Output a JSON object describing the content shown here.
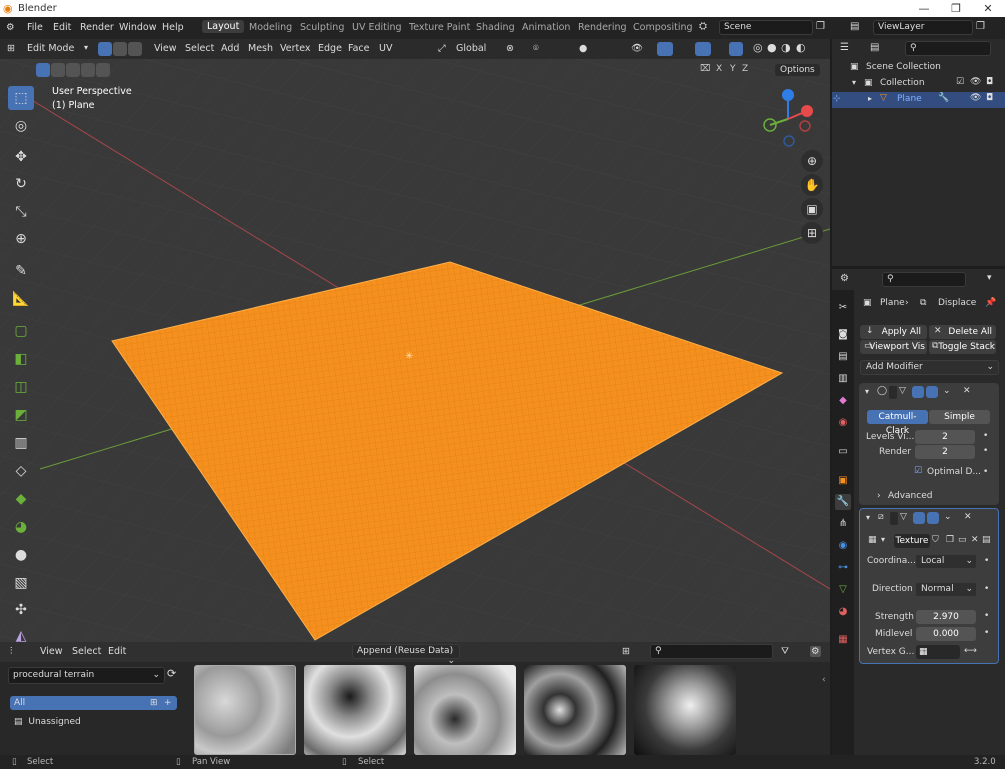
{
  "window": {
    "title": "Blender",
    "controls": [
      "—",
      "❐",
      "✕"
    ]
  },
  "menus": [
    "File",
    "Edit",
    "Render",
    "Window",
    "Help"
  ],
  "workspaces": [
    "Layout",
    "Modeling",
    "Sculpting",
    "UV Editing",
    "Texture Paint",
    "Shading",
    "Animation",
    "Rendering",
    "Compositing"
  ],
  "active_workspace": "Layout",
  "scene": "Scene",
  "view_layer": "ViewLayer",
  "header3d": {
    "mode": "Edit Mode",
    "menus": [
      "View",
      "Select",
      "Add",
      "Mesh",
      "Vertex",
      "Edge",
      "Face",
      "UV"
    ],
    "orientation": "Global",
    "axes": [
      "X",
      "Y",
      "Z"
    ],
    "options": "Options"
  },
  "viewport": {
    "perspective": "User Perspective",
    "object": "(1) Plane"
  },
  "colors": {
    "accent": "#4772b3",
    "mesh": "#f5901e",
    "x_axis": "#a8474b",
    "y_axis": "#6a9c3a"
  },
  "outliner": {
    "scene_collection": "Scene Collection",
    "collection": "Collection",
    "object": "Plane"
  },
  "properties": {
    "breadcrumb_object": "Plane",
    "breadcrumb_modifier": "Displace",
    "apply_all": "Apply All",
    "delete_all": "Delete All",
    "viewport_vis": "Viewport Vis",
    "toggle_stack": "Toggle Stack",
    "add_modifier": "Add Modifier",
    "subsurf": {
      "tab_catmull": "Catmull-Clark",
      "tab_simple": "Simple",
      "levels_label": "Levels Vi...",
      "levels_value": "2",
      "render_label": "Render",
      "render_value": "2",
      "optimal": "Optimal D...",
      "advanced": "Advanced"
    },
    "displace": {
      "texture": "Texture",
      "coord_label": "Coordina...",
      "coord_value": "Local",
      "direction_label": "Direction",
      "direction_value": "Normal",
      "strength_label": "Strength",
      "strength_value": "2.970",
      "midlevel_label": "Midlevel",
      "midlevel_value": "0.000",
      "vertex_label": "Vertex G..."
    }
  },
  "asset_browser": {
    "menus": [
      "View",
      "Select",
      "Edit"
    ],
    "import_mode": "Append (Reuse Data)",
    "library": "procedural terrain",
    "categories": [
      "All",
      "Unassigned"
    ]
  },
  "status": {
    "items": [
      "Select",
      "Pan View",
      "Select"
    ],
    "version": "3.2.0"
  }
}
